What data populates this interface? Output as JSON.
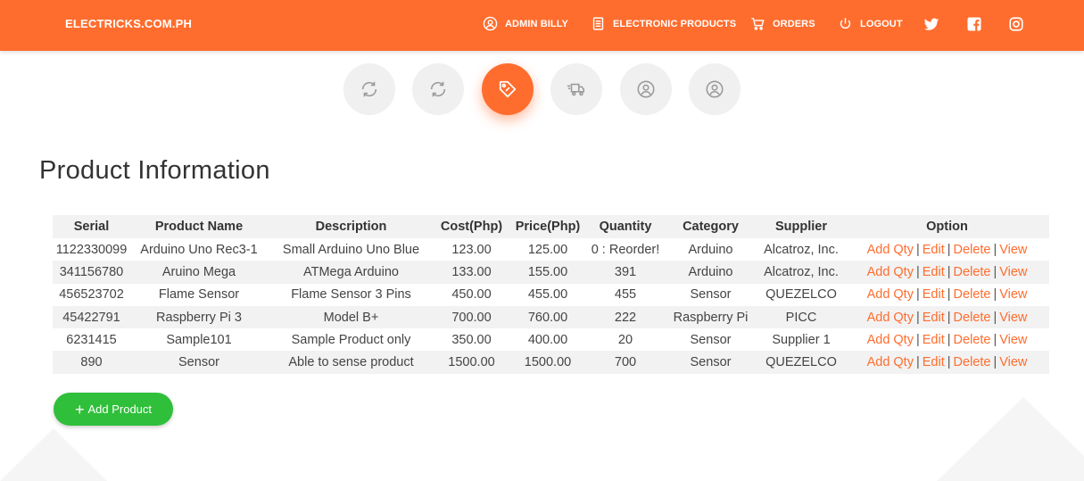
{
  "brand": "ELECTRICKS.COM.PH",
  "nav": [
    {
      "label": "ADMIN BILLY",
      "icon": "user-icon"
    },
    {
      "label": "ELECTRONIC PRODUCTS",
      "icon": "document-icon"
    },
    {
      "label": "ORDERS",
      "icon": "cart-icon"
    },
    {
      "label": "LOGOUT",
      "icon": "power-icon"
    }
  ],
  "social": [
    "twitter-icon",
    "facebook-icon",
    "instagram-icon"
  ],
  "circle_buttons": [
    {
      "icon": "refresh-icon",
      "active": false
    },
    {
      "icon": "refresh-icon",
      "active": false
    },
    {
      "icon": "tag-icon",
      "active": true
    },
    {
      "icon": "delivery-truck-icon",
      "active": false
    },
    {
      "icon": "user-icon",
      "active": false
    },
    {
      "icon": "user-icon",
      "active": false
    }
  ],
  "page_title": "Product Information",
  "table": {
    "headers": [
      "Serial",
      "Product Name",
      "Description",
      "Cost(Php)",
      "Price(Php)",
      "Quantity",
      "Category",
      "Supplier",
      "Option"
    ],
    "rows": [
      [
        "1122330099",
        "Arduino Uno Rec3-1",
        "Small Arduino Uno Blue",
        "123.00",
        "125.00",
        "0 : Reorder!",
        "Arduino",
        "Alcatroz, Inc."
      ],
      [
        "341156780",
        "Aruino Mega",
        "ATMega Arduino",
        "133.00",
        "155.00",
        "391",
        "Arduino",
        "Alcatroz, Inc."
      ],
      [
        "456523702",
        "Flame Sensor",
        "Flame Sensor 3 Pins",
        "450.00",
        "455.00",
        "455",
        "Sensor",
        "QUEZELCO"
      ],
      [
        "45422791",
        "Raspberry Pi 3",
        "Model B+",
        "700.00",
        "760.00",
        "222",
        "Raspberry Pi",
        "PICC"
      ],
      [
        "6231415",
        "Sample101",
        "Sample Product only",
        "350.00",
        "400.00",
        "20",
        "Sensor",
        "Supplier 1"
      ],
      [
        "890",
        "Sensor",
        "Able to sense product",
        "1500.00",
        "1500.00",
        "700",
        "Sensor",
        "QUEZELCO"
      ]
    ],
    "options": [
      "Add Qty",
      "Edit",
      "Delete",
      "View"
    ],
    "separator": "|"
  },
  "add_button": {
    "plus": "+",
    "label": "Add Product"
  },
  "colors": {
    "accent": "#ff6d2e",
    "success": "#2fbf3a",
    "stripe": "#f2f2f2"
  }
}
